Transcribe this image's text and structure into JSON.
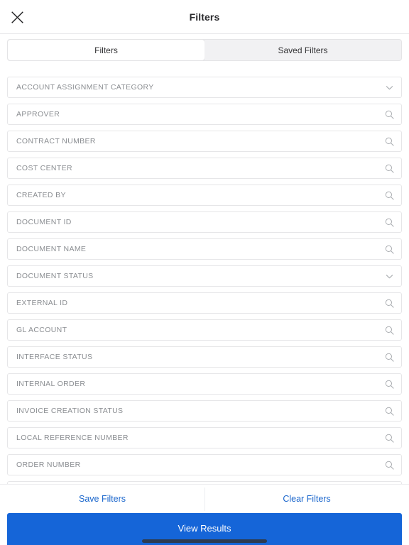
{
  "header": {
    "title": "Filters",
    "close_icon": "close-icon"
  },
  "segmented_control": {
    "tabs": [
      {
        "label": "Filters",
        "selected": true
      },
      {
        "label": "Saved Filters",
        "selected": false
      }
    ]
  },
  "filter_fields": [
    {
      "label": "ACCOUNT ASSIGNMENT CATEGORY",
      "icon": "chevron-down-icon",
      "value": ""
    },
    {
      "label": "APPROVER",
      "icon": "search-icon",
      "value": ""
    },
    {
      "label": "CONTRACT NUMBER",
      "icon": "search-icon",
      "value": ""
    },
    {
      "label": "COST CENTER",
      "icon": "search-icon",
      "value": ""
    },
    {
      "label": "CREATED BY",
      "icon": "search-icon",
      "value": ""
    },
    {
      "label": "DOCUMENT ID",
      "icon": "search-icon",
      "value": ""
    },
    {
      "label": "DOCUMENT NAME",
      "icon": "search-icon",
      "value": ""
    },
    {
      "label": "DOCUMENT STATUS",
      "icon": "chevron-down-icon",
      "value": ""
    },
    {
      "label": "EXTERNAL ID",
      "icon": "search-icon",
      "value": ""
    },
    {
      "label": "GL ACCOUNT",
      "icon": "search-icon",
      "value": ""
    },
    {
      "label": "INTERFACE STATUS",
      "icon": "search-icon",
      "value": ""
    },
    {
      "label": "INTERNAL ORDER",
      "icon": "search-icon",
      "value": ""
    },
    {
      "label": "INVOICE CREATION STATUS",
      "icon": "search-icon",
      "value": ""
    },
    {
      "label": "LOCAL REFERENCE NUMBER",
      "icon": "search-icon",
      "value": ""
    },
    {
      "label": "ORDER NUMBER",
      "icon": "search-icon",
      "value": ""
    },
    {
      "label": "",
      "icon": "search-icon",
      "value": ""
    }
  ],
  "actions": {
    "save_label": "Save Filters",
    "clear_label": "Clear Filters"
  },
  "primary_button": {
    "label": "View Results"
  },
  "colors": {
    "accent_blue": "#1565d8",
    "link_blue": "#1a66cc",
    "placeholder_gray": "#8b8e92",
    "border_gray": "#e6e6e8",
    "segment_bg": "#f1f1f3",
    "home_indicator": "#2c3b52"
  }
}
